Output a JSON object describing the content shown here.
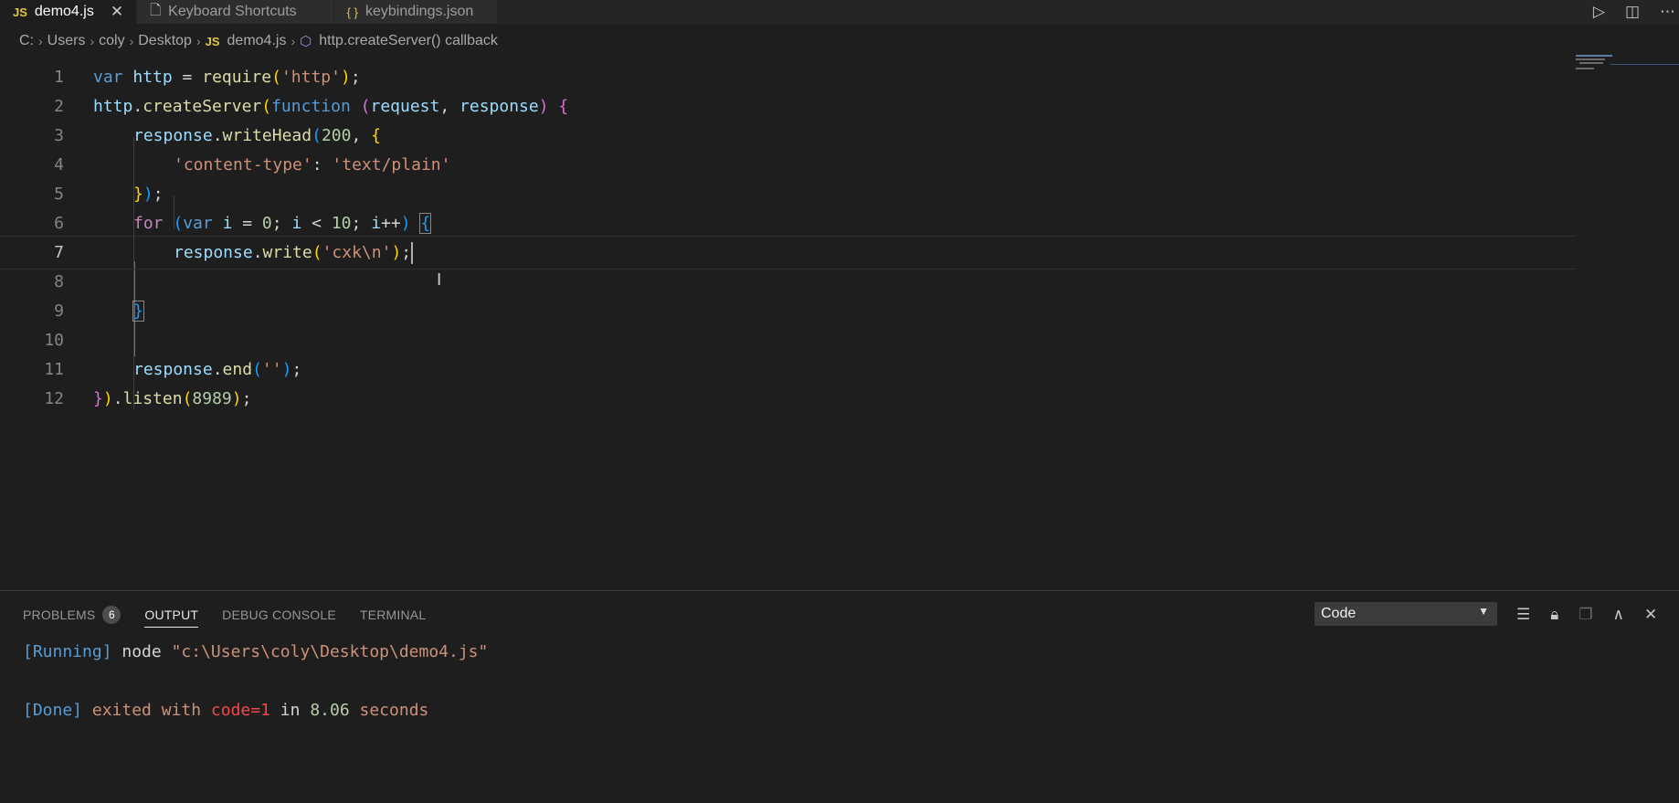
{
  "tabs": [
    {
      "icon": "JS",
      "label": "demo4.js",
      "active": true
    },
    {
      "icon": "",
      "label": "Keyboard Shortcuts",
      "active": false
    },
    {
      "icon": "{ }",
      "label": "keybindings.json",
      "active": false
    }
  ],
  "breadcrumb": [
    "C:",
    "Users",
    "coly",
    "Desktop",
    "demo4.js",
    "http.createServer() callback"
  ],
  "breadcrumb_js_icon": "JS",
  "editor": {
    "line_numbers": [
      "1",
      "2",
      "3",
      "4",
      "5",
      "6",
      "7",
      "8",
      "9",
      "10",
      "11",
      "12"
    ],
    "current_line": "7",
    "lines": [
      [
        [
          "kw",
          "var"
        ],
        [
          "plain",
          " "
        ],
        [
          "var",
          "http"
        ],
        [
          "plain",
          " = "
        ],
        [
          "fn",
          "require"
        ],
        [
          "p1",
          "("
        ],
        [
          "str",
          "'http'"
        ],
        [
          "p1",
          ")"
        ],
        [
          "plain",
          ";"
        ]
      ],
      [
        [
          "var",
          "http"
        ],
        [
          "plain",
          "."
        ],
        [
          "fn",
          "createServer"
        ],
        [
          "p1",
          "("
        ],
        [
          "kw",
          "function"
        ],
        [
          "plain",
          " "
        ],
        [
          "p2",
          "("
        ],
        [
          "var",
          "request"
        ],
        [
          "plain",
          ", "
        ],
        [
          "var",
          "response"
        ],
        [
          "p2",
          ")"
        ],
        [
          "plain",
          " "
        ],
        [
          "p2",
          "{"
        ]
      ],
      [
        [
          "var",
          "response"
        ],
        [
          "plain",
          "."
        ],
        [
          "fn",
          "writeHead"
        ],
        [
          "p3",
          "("
        ],
        [
          "num",
          "200"
        ],
        [
          "plain",
          ", "
        ],
        [
          "p1",
          "{"
        ]
      ],
      [
        [
          "str",
          "'content-type'"
        ],
        [
          "plain",
          ": "
        ],
        [
          "str",
          "'text/plain'"
        ]
      ],
      [
        [
          "p1",
          "}"
        ],
        [
          "p3",
          ")"
        ],
        [
          "plain",
          ";"
        ]
      ],
      [
        [
          "ctl",
          "for"
        ],
        [
          "plain",
          " "
        ],
        [
          "p3",
          "("
        ],
        [
          "kw",
          "var"
        ],
        [
          "plain",
          " "
        ],
        [
          "var",
          "i"
        ],
        [
          "plain",
          " = "
        ],
        [
          "num",
          "0"
        ],
        [
          "plain",
          "; "
        ],
        [
          "var",
          "i"
        ],
        [
          "plain",
          " < "
        ],
        [
          "num",
          "10"
        ],
        [
          "plain",
          "; "
        ],
        [
          "var",
          "i"
        ],
        [
          "plain",
          "++"
        ],
        [
          "p3",
          ")"
        ],
        [
          "plain",
          " "
        ],
        [
          "p3",
          "{"
        ]
      ],
      [
        [
          "var",
          "response"
        ],
        [
          "plain",
          "."
        ],
        [
          "fn",
          "write"
        ],
        [
          "p1",
          "("
        ],
        [
          "str",
          "'cxk\\n'"
        ],
        [
          "p1",
          ")"
        ],
        [
          "plain",
          ";"
        ]
      ],
      [],
      [
        [
          "p3",
          "}"
        ]
      ],
      [],
      [
        [
          "var",
          "response"
        ],
        [
          "plain",
          "."
        ],
        [
          "fn",
          "end"
        ],
        [
          "p3",
          "("
        ],
        [
          "str",
          "''"
        ],
        [
          "p3",
          ")"
        ],
        [
          "plain",
          ";"
        ]
      ],
      [
        [
          "p2",
          "}"
        ],
        [
          "p1",
          ")"
        ],
        [
          "plain",
          "."
        ],
        [
          "fn",
          "listen"
        ],
        [
          "p1",
          "("
        ],
        [
          "num",
          "8989"
        ],
        [
          "p1",
          ")"
        ],
        [
          "plain",
          ";"
        ]
      ]
    ]
  },
  "panel": {
    "tabs": [
      {
        "label": "PROBLEMS",
        "badge": "6",
        "active": false
      },
      {
        "label": "OUTPUT",
        "active": true
      },
      {
        "label": "DEBUG CONSOLE",
        "active": false
      },
      {
        "label": "TERMINAL",
        "active": false
      }
    ],
    "channel": "Code",
    "output": [
      [
        [
          "o-blue",
          "[Running]"
        ],
        [
          "o-plain",
          " node "
        ],
        [
          "o-str",
          "\"c:\\Users\\coly\\Desktop\\demo4.js\""
        ]
      ],
      [
        [
          "o-blue",
          "[Done]"
        ],
        [
          "o-kw",
          " exited with "
        ],
        [
          "o-red",
          "code=1"
        ],
        [
          "o-plain",
          " in "
        ],
        [
          "o-green",
          "8.06"
        ],
        [
          "o-kw",
          " seconds"
        ]
      ]
    ]
  },
  "colors": {
    "background": "#1e1e1e",
    "tab_bar": "#252526",
    "keyword": "#569cd6",
    "string": "#ce9178",
    "function": "#dcdcaa",
    "variable": "#9cdcfe",
    "number": "#b5cea8",
    "error": "#f44747"
  }
}
